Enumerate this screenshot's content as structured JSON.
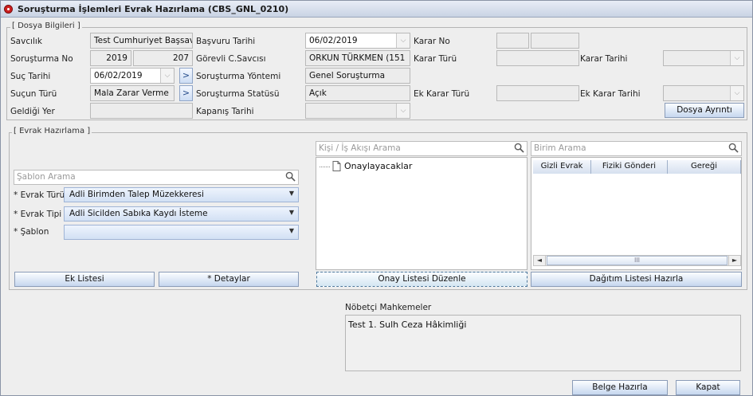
{
  "window": {
    "title": "Soruşturma İşlemleri Evrak Hazırlama (CBS_GNL_0210)"
  },
  "dosya": {
    "legend": "[ Dosya Bilgileri ]",
    "savcilik_label": "Savcılık",
    "savcilik_value": "Test Cumhuriyet Başsavcılığı",
    "sorusturma_no_label": "Soruşturma No",
    "sorusturma_yil": "2019",
    "sorusturma_no": "207",
    "suc_tarihi_label": "Suç Tarihi",
    "suc_tarihi_value": "06/02/2019",
    "sucun_turu_label": "Suçun Türü",
    "sucun_turu_value": "Mala Zarar Verme",
    "geldigi_yer_label": "Geldiği Yer",
    "basvuru_tarihi_label": "Başvuru Tarihi",
    "basvuru_tarihi_value": "06/02/2019",
    "gorevli_savci_label": "Görevli C.Savcısı",
    "gorevli_savci_value": "ORKUN TÜRKMEN (151",
    "sorusturma_yontemi_label": "Soruşturma Yöntemi",
    "sorusturma_yontemi_value": "Genel Soruşturma",
    "sorusturma_statusu_label": "Soruşturma Statüsü",
    "sorusturma_statusu_value": "Açık",
    "kapanis_tarihi_label": "Kapanış Tarihi",
    "karar_no_label": "Karar No",
    "karar_turu_label": "Karar Türü",
    "karar_tarihi_label": "Karar Tarihi",
    "ek_karar_turu_label": "Ek Karar Türü",
    "ek_karar_tarihi_label": "Ek Karar Tarihi",
    "dosya_ayrinti_label": "Dosya Ayrıntı"
  },
  "evrak": {
    "legend": "[ Evrak Hazırlama ]",
    "sablon_arama_placeholder": "Şablon Arama",
    "evrak_turu_label": "* Evrak Türü",
    "evrak_turu_value": "Adli Birimden Talep Müzekkeresi",
    "evrak_tipi_label": "* Evrak Tipi",
    "evrak_tipi_value": "Adli Sicilden Sabıka Kaydı İsteme",
    "sablon_label": "* Şablon",
    "sablon_value": "",
    "ek_listesi_label": "Ek Listesi",
    "detaylar_label": "* Detaylar",
    "kisi_arama_placeholder": "Kişi / İş Akışı Arama",
    "tree_node": "Onaylayacaklar",
    "onay_listesi_label": "Onay Listesi Düzenle",
    "birim_arama_placeholder": "Birim Arama",
    "columns": [
      "Gizli Evrak",
      "Fiziki Gönderi",
      "Gereği"
    ],
    "dagitim_label": "Dağıtım Listesi Hazırla"
  },
  "nobetci": {
    "label": "Nöbetçi Mahkemeler",
    "value": "Test 1. Sulh Ceza Hâkimliği"
  },
  "footer": {
    "belge_hazirla_label": "Belge Hazırla",
    "kapat_label": "Kapat"
  },
  "colors": {
    "title_gradient_top": "#e8edf6",
    "button_gradient_bottom": "#c6d7ef",
    "app_icon_red": "#cc1f1f"
  }
}
